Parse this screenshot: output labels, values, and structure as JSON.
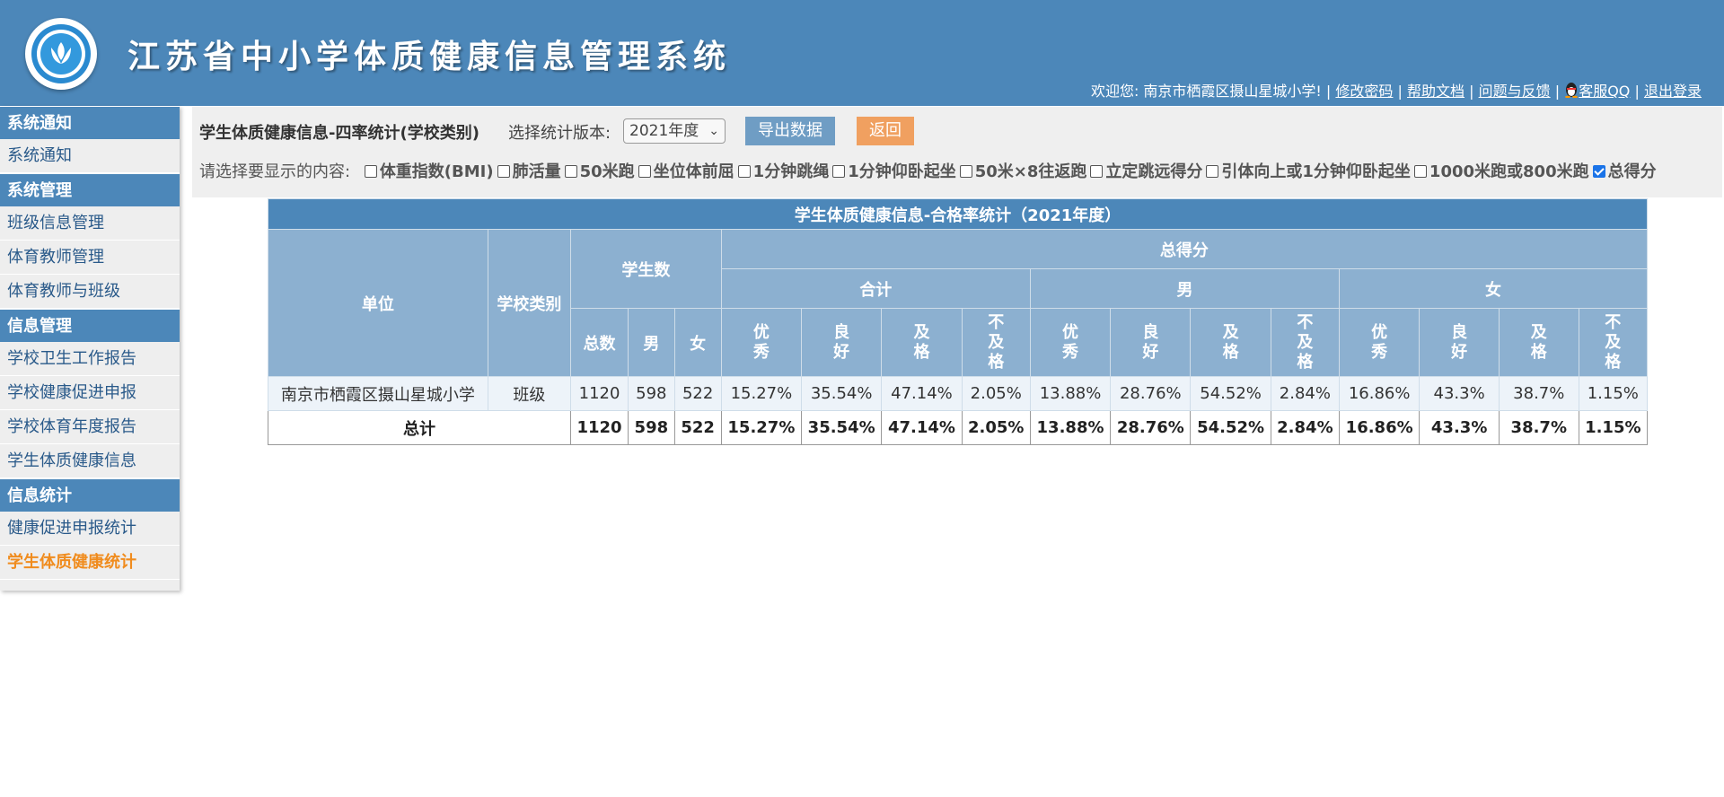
{
  "header": {
    "title": "江苏省中小学体质健康信息管理系统",
    "welcome": "欢迎您: 南京市栖霞区摄山星城小学! |",
    "links": {
      "change_password": "修改密码",
      "sep1": " |",
      "help": "帮助文档",
      "sep2": " |",
      "feedback": "问题与反馈",
      "sep3": " |",
      "qq": "客服QQ",
      "sep4": " |",
      "logout": "退出登录"
    }
  },
  "sidebar": {
    "sections": [
      {
        "title": "系统通知",
        "items": [
          "系统通知"
        ]
      },
      {
        "title": "系统管理",
        "items": [
          "班级信息管理",
          "体育教师管理",
          "体育教师与班级"
        ]
      },
      {
        "title": "信息管理",
        "items": [
          "学校卫生工作报告",
          "学校健康促进申报",
          "学校体育年度报告",
          "学生体质健康信息"
        ]
      },
      {
        "title": "信息统计",
        "items": [
          "健康促进申报统计",
          "学生体质健康统计"
        ]
      }
    ],
    "active_item": "学生体质健康统计",
    "active_color": "#f08c1e"
  },
  "toolbar": {
    "title": "学生体质健康信息-四率统计(学校类别)",
    "version_label": "选择统计版本:",
    "version_selected": "2021年度",
    "export_label": "导出数据",
    "back_label": "返回",
    "filter_label": "请选择要显示的内容:",
    "filters": [
      {
        "label": "体重指数(BMI)",
        "checked": false
      },
      {
        "label": "肺活量",
        "checked": false
      },
      {
        "label": "50米跑",
        "checked": false
      },
      {
        "label": "坐位体前屈",
        "checked": false
      },
      {
        "label": "1分钟跳绳",
        "checked": false
      },
      {
        "label": "1分钟仰卧起坐",
        "checked": false
      },
      {
        "label": "50米×8往返跑",
        "checked": false
      },
      {
        "label": "立定跳远得分",
        "checked": false
      },
      {
        "label": "引体向上或1分钟仰卧起坐",
        "checked": false
      },
      {
        "label": "1000米跑或800米跑",
        "checked": false
      },
      {
        "label": "总得分",
        "checked": true
      }
    ]
  },
  "table": {
    "caption": "学生体质健康信息-合格率统计（2021年度）",
    "headers": {
      "unit": "单位",
      "school_type": "学校类别",
      "students": "学生数",
      "total_score": "总得分",
      "total": "合计",
      "male": "男",
      "female": "女",
      "count_total": "总数",
      "count_male": "男",
      "count_female": "女",
      "levels": [
        "优秀",
        "良好",
        "及格",
        "不及格"
      ]
    },
    "rows": [
      {
        "unit": "南京市栖霞区摄山星城小学",
        "school_type": "班级",
        "total": "1120",
        "male": "598",
        "female": "522",
        "values": [
          "15.27%",
          "35.54%",
          "47.14%",
          "2.05%",
          "13.88%",
          "28.76%",
          "54.52%",
          "2.84%",
          "16.86%",
          "43.3%",
          "38.7%",
          "1.15%"
        ]
      }
    ],
    "total_row": {
      "label": "总计",
      "total": "1120",
      "male": "598",
      "female": "522",
      "values": [
        "15.27%",
        "35.54%",
        "47.14%",
        "2.05%",
        "13.88%",
        "28.76%",
        "54.52%",
        "2.84%",
        "16.86%",
        "43.3%",
        "38.7%",
        "1.15%"
      ]
    }
  }
}
